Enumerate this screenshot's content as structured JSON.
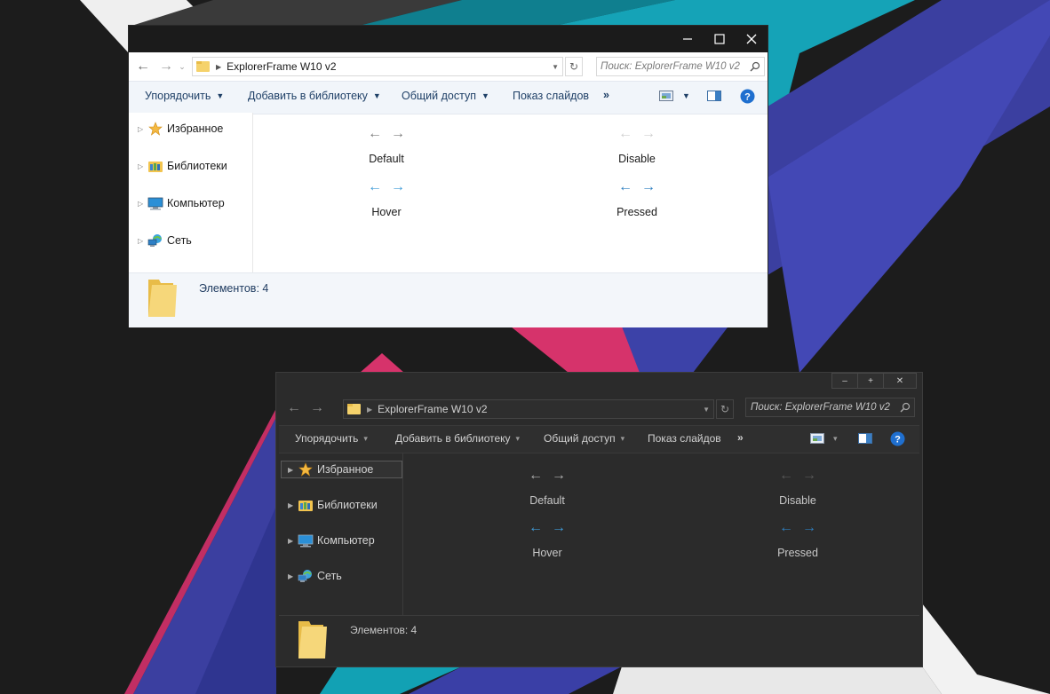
{
  "light_window": {
    "address": "ExplorerFrame W10 v2",
    "search_placeholder": "Поиск: ExplorerFrame W10 v2",
    "toolbar": {
      "organize": "Упорядочить",
      "add_library": "Добавить в библиотеку",
      "share": "Общий доступ",
      "slideshow": "Показ слайдов",
      "more": "»"
    },
    "sidebar": [
      {
        "label": "Избранное",
        "icon": "star-icon"
      },
      {
        "label": "Библиотеки",
        "icon": "library-icon"
      },
      {
        "label": "Компьютер",
        "icon": "computer-icon"
      },
      {
        "label": "Сеть",
        "icon": "network-icon"
      }
    ],
    "states": {
      "default": "Default",
      "disable": "Disable",
      "hover": "Hover",
      "pressed": "Pressed"
    },
    "item_count": "Элементов: 4"
  },
  "dark_window": {
    "address": "ExplorerFrame W10 v2",
    "search_placeholder": "Поиск: ExplorerFrame W10 v2",
    "toolbar": {
      "organize": "Упорядочить",
      "add_library": "Добавить в библиотеку",
      "share": "Общий доступ",
      "slideshow": "Показ слайдов",
      "more": "»"
    },
    "sidebar": [
      {
        "label": "Избранное",
        "icon": "star-icon"
      },
      {
        "label": "Библиотеки",
        "icon": "library-icon"
      },
      {
        "label": "Компьютер",
        "icon": "computer-icon"
      },
      {
        "label": "Сеть",
        "icon": "network-icon"
      }
    ],
    "states": {
      "default": "Default",
      "disable": "Disable",
      "hover": "Hover",
      "pressed": "Pressed"
    },
    "item_count": "Элементов: 4"
  },
  "colors": {
    "arrow_default": "#808080",
    "arrow_disabled": "#cfcfcf",
    "arrow_hover": "#3f9bd8",
    "arrow_pressed": "#2e7fc0",
    "folder": "#f6d77a",
    "wall_teal": "#12a1b4",
    "wall_blue": "#3a3fa6",
    "wall_pink": "#d6336b"
  }
}
